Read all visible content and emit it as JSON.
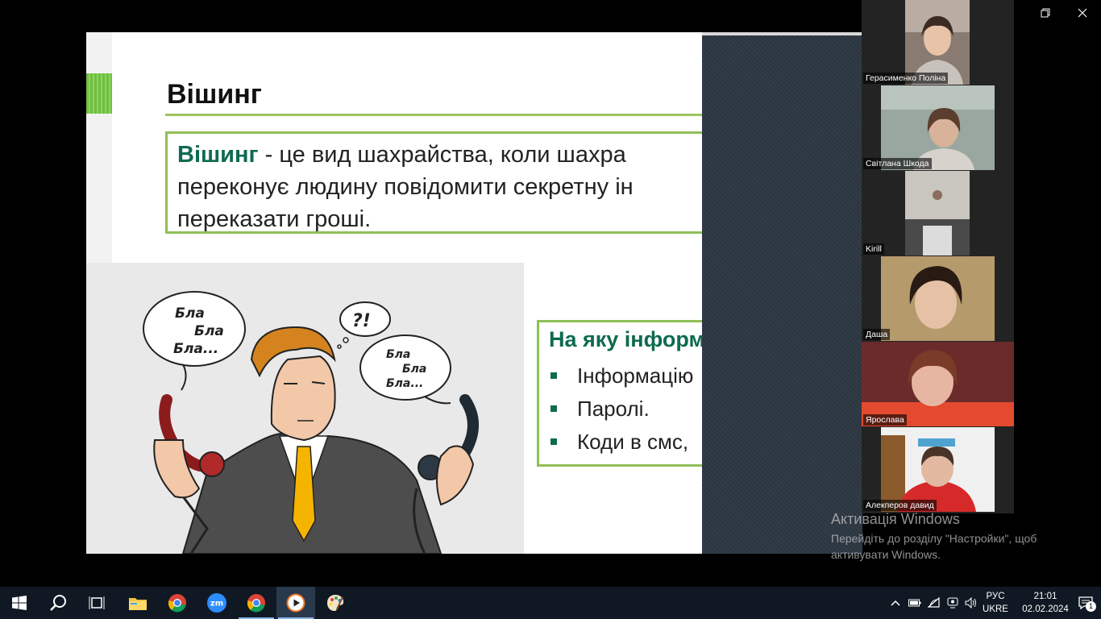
{
  "slide": {
    "title": "Вішинг",
    "definition": {
      "term": "Вішинг",
      "rest": " -   це вид шахрайства, коли шахра",
      "line2": "переконує людину повідомити секретну  ін",
      "line3": "переказати  гроші."
    },
    "speech_left": [
      "Бла",
      "Бла",
      "Бла..."
    ],
    "speech_center": "?!",
    "speech_right": [
      "Бла",
      "Бла",
      "Бла..."
    ],
    "info": {
      "heading": "На яку інформ",
      "items": [
        "Інформацію",
        "Паролі.",
        "Коди в смс,"
      ]
    }
  },
  "participants": [
    {
      "name": "Герасименко Поліна",
      "bg": "#8a7b72",
      "face": "#e9c3a8",
      "hair": "#3b2b22"
    },
    {
      "name": "Світлана Шкода",
      "bg": "#9aa7a0",
      "face": "#d9b29a",
      "hair": "#5a3e2e"
    },
    {
      "name": "Kirill",
      "bg": "#c9c6bf",
      "face": "#8c8c88",
      "hair": "#3e3e3e"
    },
    {
      "name": "Даша",
      "bg": "#b59a6c",
      "face": "#e6c1a6",
      "hair": "#2a1a14"
    },
    {
      "name": "Ярослава",
      "bg": "#6b2b2b",
      "face": "#e6b6a2",
      "hair": "#7a3b28"
    },
    {
      "name": "Алекперов давид",
      "bg": "#f0f0f0",
      "face": "#e2b9a0",
      "hair": "#4a3428"
    }
  ],
  "activation": {
    "title": "Активація Windows",
    "line1": "Перейдіть до розділу \"Настройки\", щоб",
    "line2": "активувати Windows."
  },
  "taskbar": {
    "apps": [
      "start-icon",
      "search-icon",
      "task-view-icon",
      "file-explorer-icon",
      "chrome-icon",
      "zoom-icon",
      "chrome-icon",
      "media-player-icon",
      "paint-icon"
    ],
    "lang_top": "РУС",
    "lang_bottom": "UKRE",
    "time": "21:01",
    "date": "02.02.2024",
    "notifications": "1"
  }
}
